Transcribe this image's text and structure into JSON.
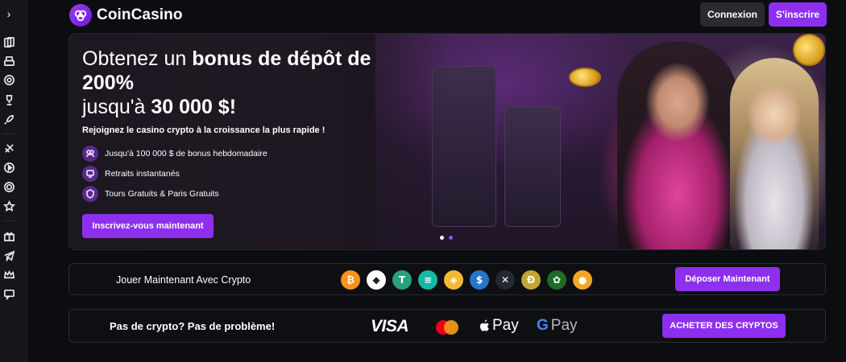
{
  "sidebar": {
    "toggle_glyph": "›",
    "icons": [
      "cards-icon",
      "casino-chips-icon",
      "poker-chip-icon",
      "trophy-icon",
      "rocket-icon",
      "sports-icon",
      "play-icon",
      "live-casino-icon",
      "star-icon",
      "gift-icon",
      "telegram-icon",
      "vip-crown-icon",
      "chat-icon"
    ]
  },
  "header": {
    "brand": "CoinCasino",
    "login_label": "Connexion",
    "signup_label": "S'inscrire"
  },
  "hero": {
    "title_part1": "Obtenez un ",
    "title_bold1": "bonus de dépôt de 200%",
    "title_part2": "jusqu'à ",
    "title_bold2": "30 000 $!",
    "subtitle": "Rejoignez le casino crypto à la croissance la plus rapide !",
    "features": [
      {
        "icon": "trophy-icon",
        "text": "Jusqu'à 100 000 $ de bonus hebdomadaire"
      },
      {
        "icon": "withdraw-icon",
        "text": "Retraits instantanés"
      },
      {
        "icon": "shield-icon",
        "text": "Tours Gratuits & Paris Gratuits"
      }
    ],
    "cta_label": "Inscrivez-vous maintenant",
    "carousel_dots": 2,
    "carousel_active": 2
  },
  "crypto_bar": {
    "label": "Jouer Maintenant Avec Crypto",
    "coins": [
      {
        "name": "bitcoin-icon",
        "glyph": "₿",
        "color": "#f7931a"
      },
      {
        "name": "ethereum-icon",
        "glyph": "◆",
        "color": "#ffffff"
      },
      {
        "name": "tether-icon",
        "glyph": "T",
        "color": "#26a17b"
      },
      {
        "name": "solana-icon",
        "glyph": "≡",
        "color": "#14b8a6"
      },
      {
        "name": "bnb-icon",
        "glyph": "◈",
        "color": "#f3ba2f"
      },
      {
        "name": "usdc-icon",
        "glyph": "$",
        "color": "#2775ca"
      },
      {
        "name": "xrp-icon",
        "glyph": "✕",
        "color": "#23292f"
      },
      {
        "name": "dogecoin-icon",
        "glyph": "Ð",
        "color": "#c2a633"
      },
      {
        "name": "rose-token-icon",
        "glyph": "✿",
        "color": "#1f6b2a"
      },
      {
        "name": "shiba-icon",
        "glyph": "●",
        "color": "#f5a623"
      }
    ],
    "deposit_label": "Déposer Maintenant"
  },
  "fiat_bar": {
    "label": "Pas de crypto? Pas de problème!",
    "visa_label": "VISA",
    "applepay_label": "Pay",
    "googlepay_label": "Pay",
    "buy_label": "ACHETER DES CRYPTOS"
  },
  "colors": {
    "accent": "#8e2ff0",
    "background": "#0c0d10",
    "panel_border": "#2b2c33"
  }
}
